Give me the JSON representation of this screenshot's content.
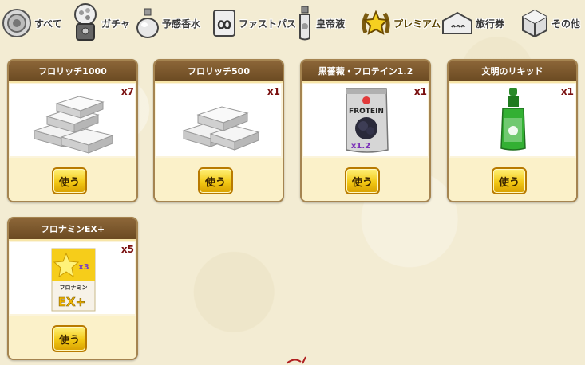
{
  "tabs": [
    {
      "label": "すべて",
      "icon": "circle-all-icon"
    },
    {
      "label": "ガチャ",
      "icon": "gacha-machine-icon"
    },
    {
      "label": "予感香水",
      "icon": "perfume-bottle-icon"
    },
    {
      "label": "ファストパス",
      "icon": "fastpass-icon"
    },
    {
      "label": "皇帝液",
      "icon": "emperor-liquid-bottle-icon"
    },
    {
      "label": "プレミアム",
      "icon": "premium-star-laurel-icon"
    },
    {
      "label": "旅行券",
      "icon": "travel-ticket-icon"
    },
    {
      "label": "その他",
      "icon": "other-cube-icon"
    }
  ],
  "active_tab": "プレミアム",
  "items": [
    {
      "name": "フロリッチ1000",
      "qty": "x7",
      "button": "使う",
      "image": "silver-bars-icon"
    },
    {
      "name": "フロリッチ500",
      "qty": "x1",
      "button": "使う",
      "image": "silver-bars-icon"
    },
    {
      "name": "黒薔薇・フロテイン1.2",
      "qty": "x1",
      "button": "使う",
      "image": "protein-bag-icon",
      "image_text": [
        "FROTEIN",
        "x1.2"
      ]
    },
    {
      "name": "文明のリキッド",
      "qty": "x1",
      "button": "使う",
      "image": "dropper-bottle-icon"
    },
    {
      "name": "フロナミンEX+",
      "qty": "x5",
      "button": "使う",
      "image": "energy-drink-box-icon",
      "image_text": [
        "x3",
        "フロナミン",
        "EX+"
      ]
    }
  ]
}
